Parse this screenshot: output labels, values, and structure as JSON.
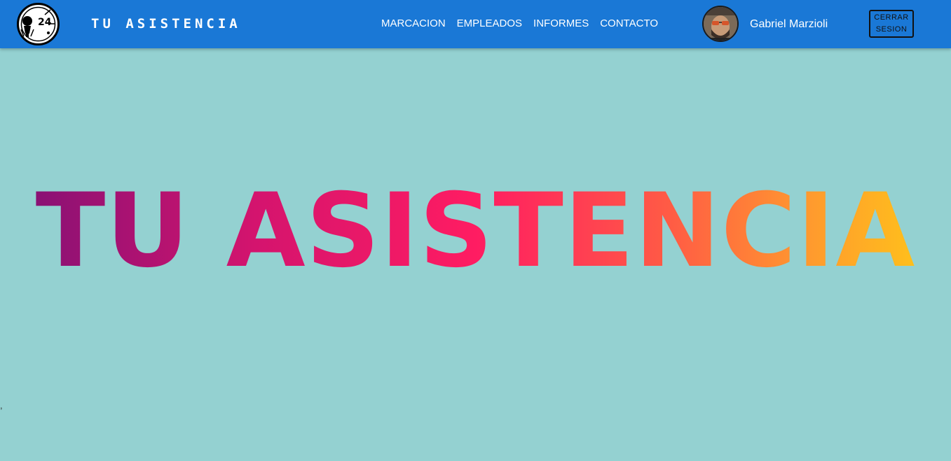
{
  "header": {
    "brand": "TU ASISTENCIA",
    "logo_text": "24",
    "nav": [
      "MARCACION",
      "EMPLEADOS",
      "INFORMES",
      "CONTACTO"
    ],
    "user_name": "Gabriel Marzioli",
    "logout_label": "CERRAR SESION"
  },
  "main": {
    "hero_title": "TU ASISTENCIA",
    "stray_text": ","
  },
  "colors": {
    "navbar": "#1a78d6",
    "page_background": "#94d1d1",
    "gradient": [
      "#8a1174",
      "#d4146e",
      "#ff1c62",
      "#ff5b45",
      "#ff9a2e",
      "#ffbf1c"
    ]
  }
}
